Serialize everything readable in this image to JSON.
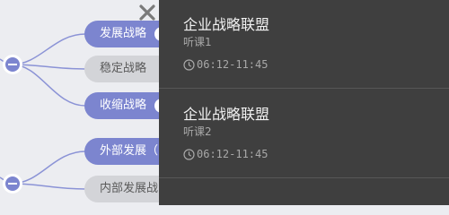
{
  "mindmap": {
    "nodes": [
      {
        "label": "发展战略",
        "state": "active"
      },
      {
        "label": "稳定战略",
        "state": "muted"
      },
      {
        "label": "收缩战略",
        "state": "active"
      },
      {
        "label": "外部发展（",
        "state": "active"
      },
      {
        "label": "内部发展战",
        "state": "muted"
      }
    ],
    "colors": {
      "active": "#7c85cf",
      "muted": "#d3d4d8",
      "line": "#8b93d6"
    }
  },
  "panel": {
    "entries": [
      {
        "title": "企业战略联盟",
        "subtitle": "听课1",
        "time": "06:12-11:45"
      },
      {
        "title": "企业战略联盟",
        "subtitle": "听课2",
        "time": "06:12-11:45"
      }
    ]
  }
}
